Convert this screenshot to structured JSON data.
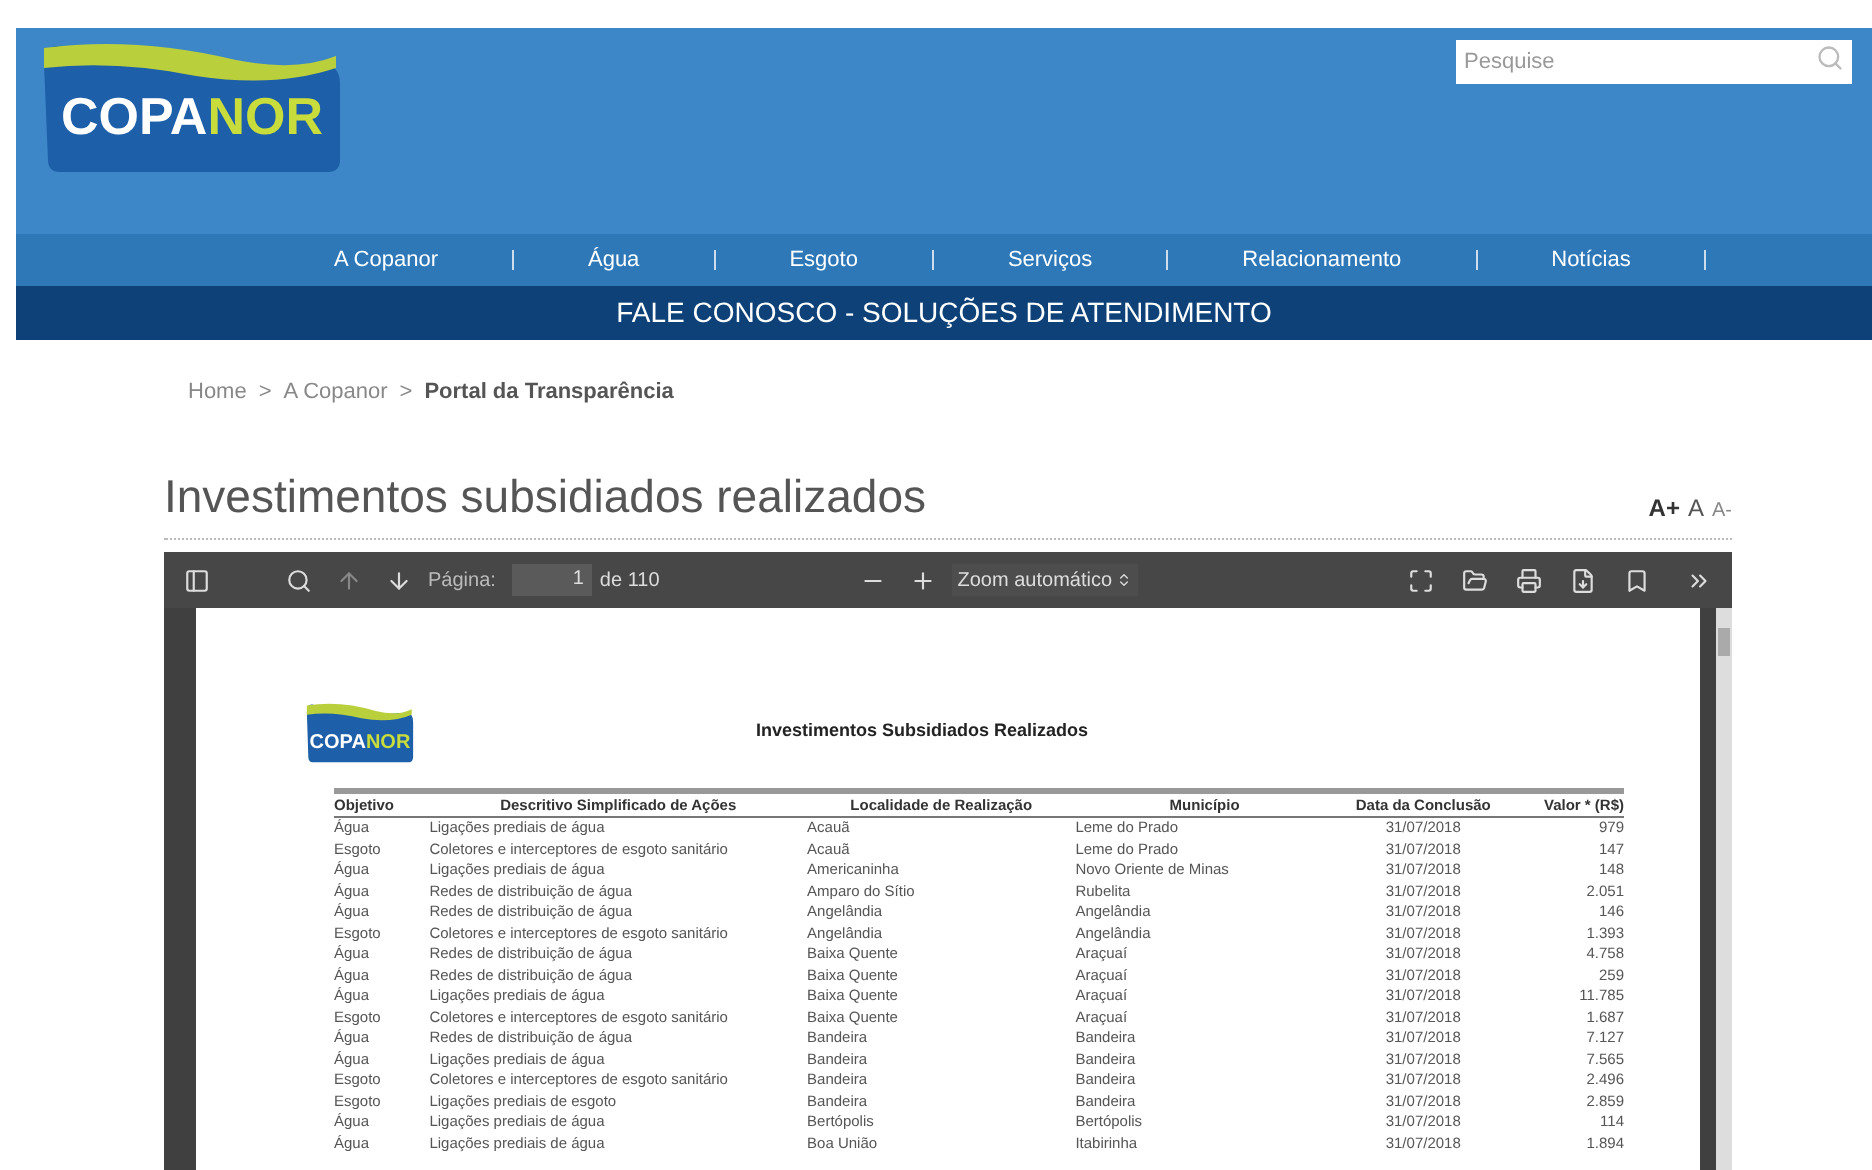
{
  "header": {
    "logo": {
      "part_1": "COPA",
      "part_2": "NOR"
    },
    "search": {
      "placeholder": "Pesquise"
    }
  },
  "nav": [
    "A Copanor",
    "Água",
    "Esgoto",
    "Serviços",
    "Relacionamento",
    "Notícias"
  ],
  "banner": "FALE CONOSCO - SOLUÇÕES DE ATENDIMENTO",
  "breadcrumb": [
    {
      "label": "Home",
      "current": false
    },
    {
      "label": "A Copanor",
      "current": false
    },
    {
      "label": "Portal da Transparência",
      "current": true
    }
  ],
  "breadcrumb_separator": ">",
  "page_title": "Investimentos subsidiados realizados",
  "font_controls": [
    "A+",
    "A",
    "A-"
  ],
  "viewer": {
    "toolbar": {
      "page_label": "Página:",
      "page_value": "1",
      "page_total": "de 110",
      "zoom": "Zoom automático"
    },
    "document": {
      "logo": {
        "part_1": "COPA",
        "part_2": "NOR"
      },
      "title": "Investimentos Subsidiados Realizados",
      "columns": [
        "Objetivo",
        "Descritivo Simplificado de Ações",
        "Localidade de Realização",
        "Município",
        "Data da Conclusão",
        "Valor * (R$)"
      ],
      "rows": [
        [
          "Água",
          "Ligações prediais de água",
          "Acauã",
          "Leme do Prado",
          "31/07/2018",
          "979"
        ],
        [
          "Esgoto",
          "Coletores e interceptores de esgoto sanitário",
          "Acauã",
          "Leme do Prado",
          "31/07/2018",
          "147"
        ],
        [
          "Água",
          "Ligações prediais de água",
          "Americaninha",
          "Novo Oriente de Minas",
          "31/07/2018",
          "148"
        ],
        [
          "Água",
          "Redes de distribuição de água",
          "Amparo do Sítio",
          "Rubelita",
          "31/07/2018",
          "2.051"
        ],
        [
          "Água",
          "Redes de distribuição de água",
          "Angelândia",
          "Angelândia",
          "31/07/2018",
          "146"
        ],
        [
          "Esgoto",
          "Coletores e interceptores de esgoto sanitário",
          "Angelândia",
          "Angelândia",
          "31/07/2018",
          "1.393"
        ],
        [
          "Água",
          "Redes de distribuição de água",
          "Baixa Quente",
          "Araçuaí",
          "31/07/2018",
          "4.758"
        ],
        [
          "Água",
          "Redes de distribuição de água",
          "Baixa Quente",
          "Araçuaí",
          "31/07/2018",
          "259"
        ],
        [
          "Água",
          "Ligações prediais de água",
          "Baixa Quente",
          "Araçuaí",
          "31/07/2018",
          "11.785"
        ],
        [
          "Esgoto",
          "Coletores e interceptores de esgoto sanitário",
          "Baixa Quente",
          "Araçuaí",
          "31/07/2018",
          "1.687"
        ],
        [
          "Água",
          "Redes de distribuição de água",
          "Bandeira",
          "Bandeira",
          "31/07/2018",
          "7.127"
        ],
        [
          "Água",
          "Ligações prediais de água",
          "Bandeira",
          "Bandeira",
          "31/07/2018",
          "7.565"
        ],
        [
          "Esgoto",
          "Coletores e interceptores de esgoto sanitário",
          "Bandeira",
          "Bandeira",
          "31/07/2018",
          "2.496"
        ],
        [
          "Esgoto",
          "Ligações prediais de esgoto",
          "Bandeira",
          "Bandeira",
          "31/07/2018",
          "2.859"
        ],
        [
          "Água",
          "Ligações prediais de água",
          "Bertópolis",
          "Bertópolis",
          "31/07/2018",
          "114"
        ],
        [
          "Água",
          "Ligações prediais de água",
          "Boa União",
          "Itabirinha",
          "31/07/2018",
          "1.894"
        ]
      ]
    }
  }
}
